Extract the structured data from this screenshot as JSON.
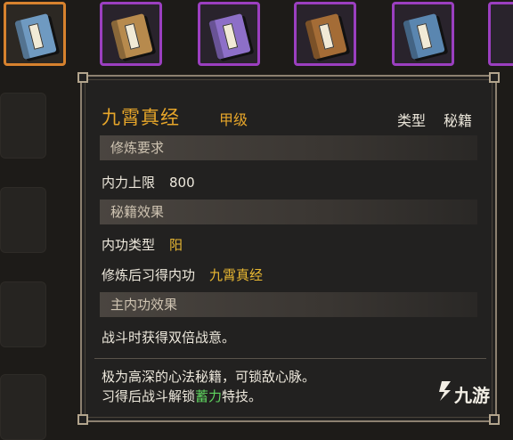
{
  "inventory": {
    "slots": [
      {
        "name": "item-slot-1",
        "book_color": "#6f9ac1",
        "state": "selected"
      },
      {
        "name": "item-slot-2",
        "book_color": "#b78a4d",
        "state": "purple"
      },
      {
        "name": "item-slot-3",
        "book_color": "#8d6fc8",
        "state": "purple"
      },
      {
        "name": "item-slot-4",
        "book_color": "#a46c36",
        "state": "purple"
      },
      {
        "name": "item-slot-5",
        "book_color": "#5a86b0",
        "state": "purple"
      }
    ]
  },
  "tooltip": {
    "title": "九霄真经",
    "grade": "甲级",
    "type_label": "类型",
    "type_value": "秘籍",
    "sections": {
      "requirements": "修炼要求",
      "effects": "秘籍效果",
      "main_effect": "主内功效果"
    },
    "rows": {
      "neili_label": "内力上限",
      "neili_value": "800",
      "neigong_type_label": "内功类型",
      "neigong_type_value": "阳",
      "learn_label": "修炼后习得内功",
      "learn_value": "九霄真经",
      "main_effect_text": "战斗时获得双倍战意。"
    },
    "description": {
      "line1": "极为高深的心法秘籍，可锁敌心脉。",
      "line2_prefix": "习得后战斗解锁",
      "line2_highlight": "蓄力",
      "line2_suffix": "特技。"
    }
  },
  "watermark": {
    "text": "九游"
  },
  "colors": {
    "accent_gold": "#e7a62a",
    "highlight_green": "#5fd45f",
    "selected_border": "#d7822e",
    "purple_border": "#9b3fc0"
  }
}
